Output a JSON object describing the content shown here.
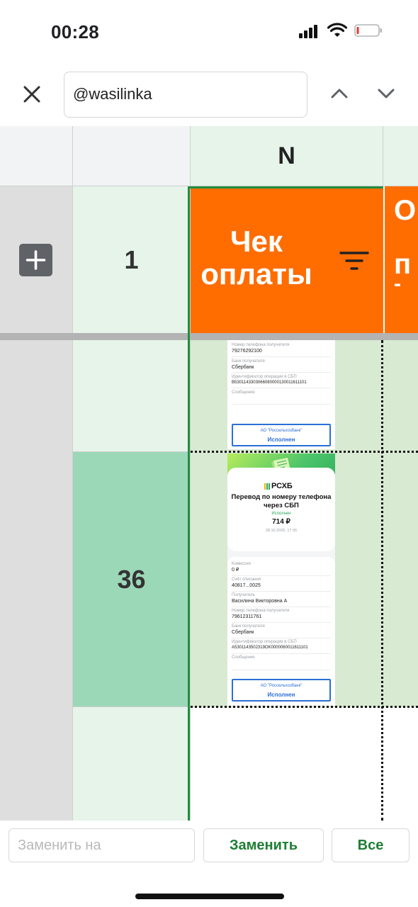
{
  "status_bar": {
    "time": "00:28"
  },
  "find_bar": {
    "query": "@wasilinka"
  },
  "sheet": {
    "column_letter": "N",
    "header_row_number": "1",
    "header_cell": {
      "line1": "Чек",
      "line2": "оплаты"
    },
    "next_header_partial": {
      "line1": "О",
      "line2": "п",
      "line3": "-"
    },
    "selected_row_number": "36",
    "colors": {
      "header_orange": "#ff6d01",
      "cell_green": "#d9ead3",
      "row_header_green": "#e6f4ea",
      "selected_row_header": "#9bd8b8",
      "selection_border": "#1e8e3e"
    }
  },
  "receipt_top": {
    "phone_label": "Номер телефона получателя",
    "phone_value": "79276292100",
    "bank_label": "Банк получателя",
    "bank_value": "Сбербанк",
    "opid_label": "Идентификатор операции в СБП",
    "opid_value": "B5301143303066080000130011611101",
    "message_label": "Сообщение",
    "bank_box_name": "АО \"Россельхозбанк\"",
    "bank_box_status": "Исполнен"
  },
  "receipt_main": {
    "logo": "РСХБ",
    "title": "Перевод по номеру телефона через СБП",
    "status": "Исполнен",
    "amount": "714 ₽",
    "datetime": "28.10.2025, 17:35",
    "fields": [
      {
        "label": "Комиссия",
        "value": "0 ₽"
      },
      {
        "label": "Счёт списания",
        "value": "40817...0025"
      },
      {
        "label": "Получатель",
        "value": "Василина Викторовна А"
      },
      {
        "label": "Номер телефона получателя",
        "value": "79612311761"
      },
      {
        "label": "Банк получателя",
        "value": "Сбербанк"
      },
      {
        "label": "Идентификатор операции в СБП",
        "value": "A5301143502319OK0000060011611101"
      },
      {
        "label": "Сообщение",
        "value": ""
      }
    ],
    "bank_box_name": "АО \"Россельхозбанк\"",
    "bank_box_status": "Исполнен"
  },
  "replace_bar": {
    "placeholder": "Заменить на",
    "replace_label": "Заменить",
    "all_label": "Все"
  },
  "icons": [
    "signal-icon",
    "wifi-icon",
    "battery-icon",
    "close-icon",
    "chevron-up-icon",
    "chevron-down-icon",
    "plus-icon",
    "filter-icon",
    "rshb-logo-icon"
  ]
}
